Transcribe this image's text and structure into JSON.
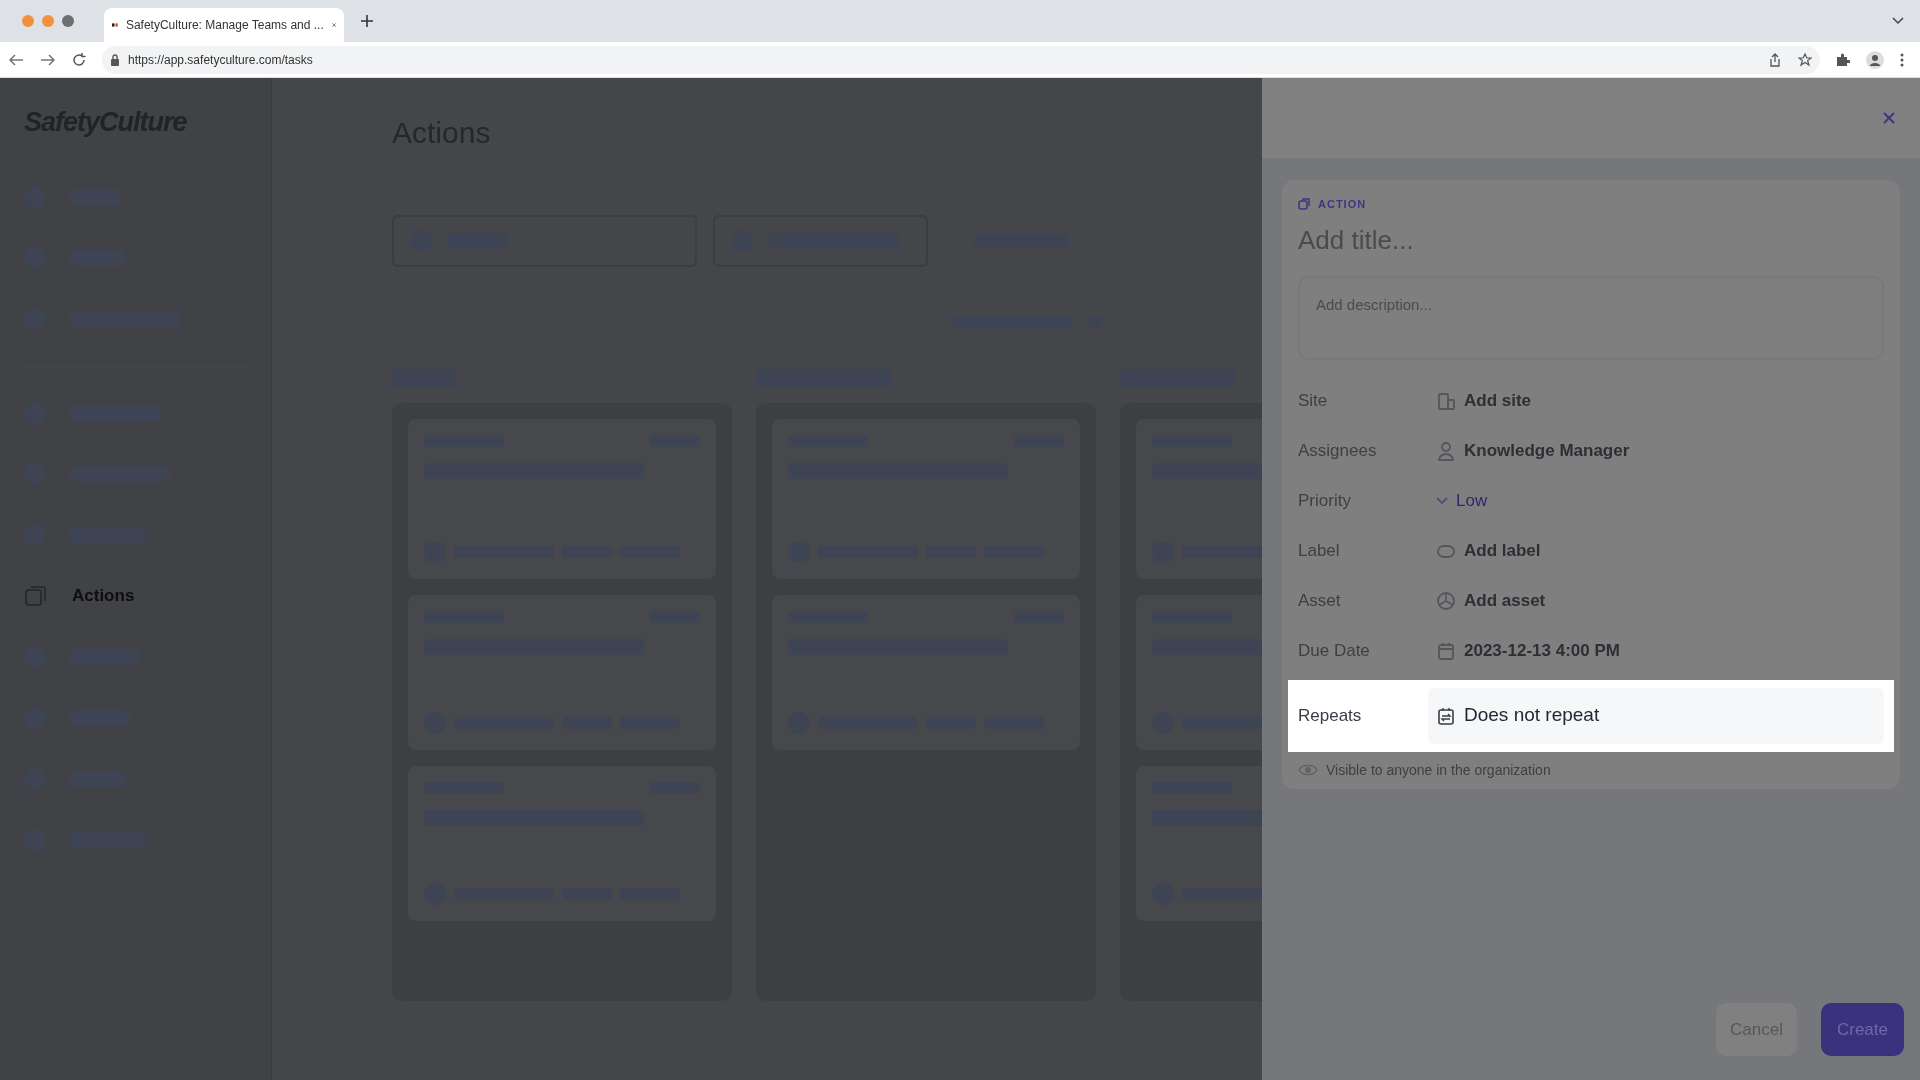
{
  "browser": {
    "tab_title": "SafetyCulture: Manage Teams and ...",
    "url": "https://app.safetyculture.com/tasks"
  },
  "sidebar": {
    "logo": "SafetyCulture",
    "current_item": "Actions"
  },
  "page": {
    "title": "Actions"
  },
  "panel": {
    "type_label": "ACTION",
    "title_placeholder": "Add title...",
    "description_placeholder": "Add description...",
    "fields": [
      {
        "label": "Site",
        "value": "Add site",
        "kind": "site",
        "highlighted": false
      },
      {
        "label": "Assignees",
        "value": "Knowledge Manager",
        "kind": "assignee",
        "highlighted": false
      },
      {
        "label": "Priority",
        "value": "Low",
        "kind": "priority",
        "highlighted": false
      },
      {
        "label": "Label",
        "value": "Add label",
        "kind": "label",
        "highlighted": false
      },
      {
        "label": "Asset",
        "value": "Add asset",
        "kind": "asset",
        "highlighted": false
      },
      {
        "label": "Due Date",
        "value": "2023-12-13 4:00 PM",
        "kind": "date",
        "highlighted": false
      },
      {
        "label": "Repeats",
        "value": "Does not repeat",
        "kind": "repeat",
        "highlighted": true
      }
    ],
    "visibility": "Visible to anyone in the organization",
    "buttons": [
      {
        "label": "Cancel",
        "kind": "secondary"
      },
      {
        "label": "Create",
        "kind": "primary"
      }
    ]
  }
}
